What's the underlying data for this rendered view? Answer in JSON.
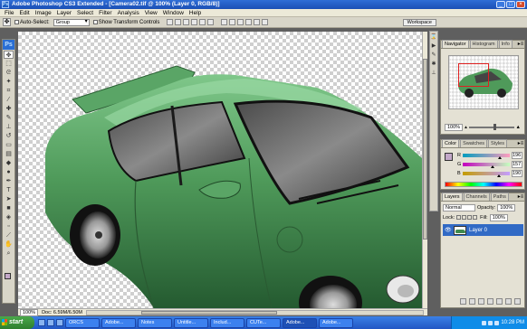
{
  "window": {
    "title": "Adobe Photoshop CS3 Extended - [Camera02.tif @ 100% (Layer 0, RGB/8)]",
    "logo": "Ps"
  },
  "menu": [
    "File",
    "Edit",
    "Image",
    "Layer",
    "Select",
    "Filter",
    "Analysis",
    "View",
    "Window",
    "Help"
  ],
  "options": {
    "auto_select_label": "Auto-Select:",
    "auto_select_value": "Group",
    "show_transform_label": "Show Transform Controls",
    "workspace_label": "Workspace"
  },
  "document": {
    "zoom": "100%",
    "doc_info": "Doc: 6.59M/6.50M"
  },
  "panels": {
    "navigator_tabs": [
      "Navigator",
      "Histogram",
      "Info"
    ],
    "navigator_zoom": "100%",
    "color_tabs": [
      "Color",
      "Swatches",
      "Styles"
    ],
    "color": {
      "R": "196",
      "G": "157",
      "B": "190"
    },
    "layers_tabs": [
      "Layers",
      "Channels",
      "Paths"
    ],
    "blend_mode": "Normal",
    "opacity_label": "Opacity:",
    "opacity": "100%",
    "lock_label": "Lock:",
    "fill_label": "Fill:",
    "fill": "100%",
    "layer_name": "Layer 0"
  },
  "taskbar": {
    "start_label": "start",
    "buttons": [
      "ORCS",
      "Adobe...",
      "Notes",
      "Untitle...",
      "Includ...",
      "CUTe...",
      "Adobe...",
      "Adobe..."
    ],
    "clock": "10:28 PM"
  },
  "colors": {
    "car_body": "#4f9a5a",
    "accent": "#316ac5"
  }
}
